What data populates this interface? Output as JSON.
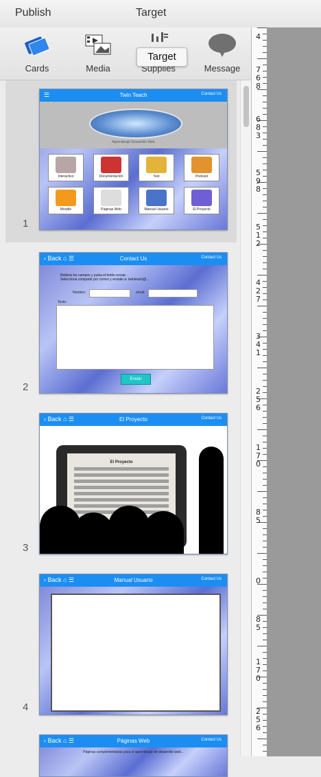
{
  "menubar": {
    "left": "Publish",
    "center": "Target"
  },
  "toolbar": {
    "items": [
      {
        "label": "Cards",
        "icon": "cards-icon"
      },
      {
        "label": "Media",
        "icon": "media-icon"
      },
      {
        "label": "Supplies",
        "icon": "supplies-icon"
      },
      {
        "label": "Message",
        "icon": "message-icon"
      }
    ],
    "tooltip": "Target"
  },
  "slides": [
    {
      "number": "1",
      "title": "Twin Teach",
      "right": "Contact Us",
      "tagline": "Aprendizaje Desarrollo Web",
      "cards": [
        "Interactivo",
        "Documentación",
        "Test",
        "Podcast",
        "Moodle",
        "Páginas Web",
        "Manual Usuario",
        "El Proyecto"
      ]
    },
    {
      "number": "2",
      "title": "Contact Us",
      "left": "Back",
      "right": "Contact Us",
      "bullets": [
        "Rellena los campos y pulsa el botón enviar.",
        "Selecciona compartir por correo y envialo a: twinteach@..."
      ],
      "fields": {
        "name": "Nombre:",
        "email": "email:",
        "text": "Texto:"
      },
      "button": "Enviar"
    },
    {
      "number": "3",
      "title": "El Proyecto",
      "left": "Back",
      "right": "Contact Us",
      "heading": "El Proyecto"
    },
    {
      "number": "4",
      "title": "Manual Usuario",
      "left": "Back",
      "right": "Contact Us"
    },
    {
      "title": "Páginas Web",
      "left": "Back",
      "right": "Contact Us",
      "subtitle": "Páginas complementarias para el aprendizaje de desarrollo web..."
    }
  ],
  "ruler": {
    "labels": [
      [
        "4"
      ],
      [
        "7",
        "6",
        "8"
      ],
      [
        "6",
        "8",
        "3"
      ],
      [
        "5",
        "9",
        "8"
      ],
      [
        "5",
        "1",
        "2"
      ],
      [
        "4",
        "2",
        "7"
      ],
      [
        "3",
        "4",
        "1"
      ],
      [
        "2",
        "5",
        "6"
      ],
      [
        "1",
        "7",
        "0"
      ],
      [
        "8",
        "5"
      ],
      [
        "0"
      ],
      [
        "8",
        "5"
      ],
      [
        "1",
        "7",
        "0"
      ],
      [
        "2",
        "5",
        "6"
      ]
    ]
  },
  "colors": {
    "slide_bar": "#1c8ef2",
    "canvas": "#9a9a9a",
    "accent_button": "#20c5c8"
  }
}
